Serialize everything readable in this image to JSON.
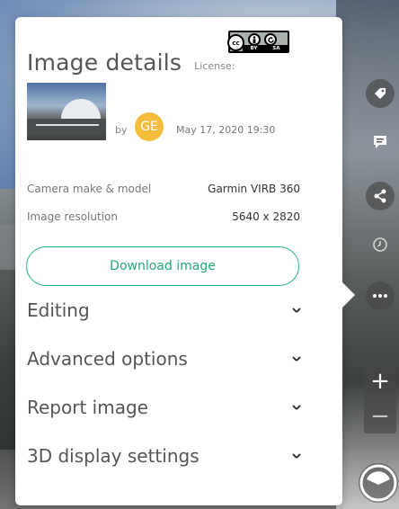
{
  "panel": {
    "title": "Image details",
    "license_label": "License:",
    "license_badge": {
      "by_text": "BY",
      "sa_text": "SA",
      "cc_text": "cc"
    },
    "author": {
      "by_label": "by",
      "initials": "GE",
      "avatar_color": "#f6bd3c",
      "date": "May 17, 2020 19:30"
    },
    "meta": [
      {
        "label": "Camera make & model",
        "value": "Garmin VIRB 360"
      },
      {
        "label": "Image resolution",
        "value": "5640 x 2820"
      }
    ],
    "download_label": "Download image",
    "sections": [
      {
        "label": "Editing"
      },
      {
        "label": "Advanced options"
      },
      {
        "label": "Report image"
      },
      {
        "label": "3D display settings"
      }
    ]
  },
  "toolbar": {
    "tools": [
      "tag-icon",
      "comment-icon",
      "share-icon",
      "history-icon",
      "more-icon"
    ],
    "zoom_in": "+",
    "zoom_out": "−"
  },
  "colors": {
    "accent": "#29b27a",
    "avatar": "#f6bd3c",
    "panel_bg": "#ffffff"
  }
}
